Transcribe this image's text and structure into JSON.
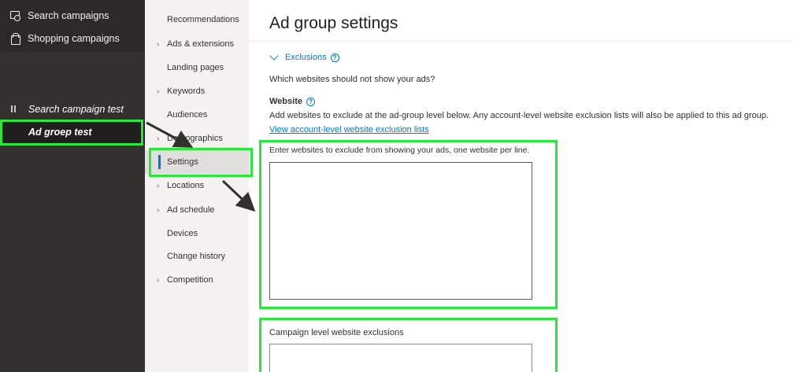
{
  "sidebar": {
    "items": [
      {
        "label": "Search campaigns",
        "icon": "search-campaign-icon"
      },
      {
        "label": "Shopping campaigns",
        "icon": "shopping-bag-icon"
      }
    ],
    "tree": {
      "campaign": "Search campaign test",
      "ad_group": "Ad groep test"
    }
  },
  "subnav": {
    "items": [
      {
        "label": "Recommendations",
        "chevron": false
      },
      {
        "label": "Ads & extensions",
        "chevron": true
      },
      {
        "label": "Landing pages",
        "chevron": false
      },
      {
        "label": "Keywords",
        "chevron": true
      },
      {
        "label": "Audiences",
        "chevron": false
      },
      {
        "label": "Demographics",
        "chevron": true
      },
      {
        "label": "Settings",
        "chevron": false,
        "active": true
      },
      {
        "label": "Locations",
        "chevron": true
      },
      {
        "label": "Ad schedule",
        "chevron": true
      },
      {
        "label": "Devices",
        "chevron": false
      },
      {
        "label": "Change history",
        "chevron": false
      },
      {
        "label": "Competition",
        "chevron": true
      }
    ]
  },
  "main": {
    "title": "Ad group settings",
    "section_toggle": "Exclusions",
    "question": "Which websites should not show your ads?",
    "website_label": "Website",
    "description": "Add websites to exclude at the ad-group level below. Any account-level website exclusion lists will also be applied to this ad group.",
    "link": "View account-level website exclusion lists",
    "textarea_label": "Enter websites to exclude from showing your ads, one website per line.",
    "textarea_value": "",
    "campaign_exclusions_label": "Campaign level website exclusions"
  },
  "colors": {
    "highlight": "#28e83a",
    "accent": "#0078d4",
    "sidebar_bg": "#323130"
  }
}
